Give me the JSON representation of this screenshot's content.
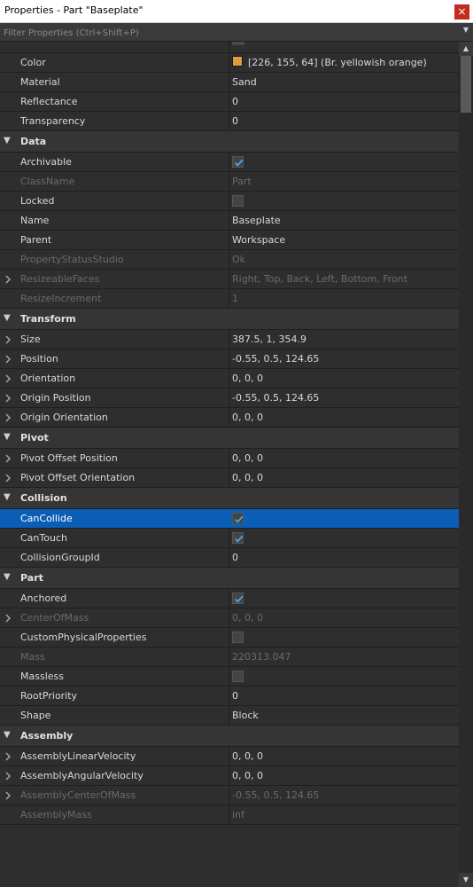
{
  "window": {
    "title": "Properties - Part \"Baseplate\"",
    "close_glyph": "×"
  },
  "filter": {
    "placeholder": "Filter Properties (Ctrl+Shift+P)"
  },
  "colors": {
    "selection": "#0a5eb6",
    "color_swatch": "#e29b40",
    "checkmark": "#4aa3f0"
  },
  "rows": [
    {
      "kind": "prop",
      "name": "Color",
      "value": "[226, 155, 64] (Br. yellowish orange)",
      "swatch": true
    },
    {
      "kind": "prop",
      "name": "Material",
      "value": "Sand"
    },
    {
      "kind": "prop",
      "name": "Reflectance",
      "value": "0"
    },
    {
      "kind": "prop",
      "name": "Transparency",
      "value": "0"
    },
    {
      "kind": "category",
      "name": "Data"
    },
    {
      "kind": "check",
      "name": "Archivable",
      "checked": true
    },
    {
      "kind": "prop",
      "name": "ClassName",
      "value": "Part",
      "disabled": true
    },
    {
      "kind": "check",
      "name": "Locked",
      "checked": false
    },
    {
      "kind": "prop",
      "name": "Name",
      "value": "Baseplate"
    },
    {
      "kind": "prop",
      "name": "Parent",
      "value": "Workspace"
    },
    {
      "kind": "prop",
      "name": "PropertyStatusStudio",
      "value": "Ok",
      "disabled": true
    },
    {
      "kind": "prop",
      "name": "ResizeableFaces",
      "value": "Right, Top, Back, Left, Bottom, Front",
      "disabled": true,
      "expandable": true
    },
    {
      "kind": "prop",
      "name": "ResizeIncrement",
      "value": "1",
      "disabled": true
    },
    {
      "kind": "category",
      "name": "Transform"
    },
    {
      "kind": "prop",
      "name": "Size",
      "value": "387.5, 1, 354.9",
      "expandable": true
    },
    {
      "kind": "prop",
      "name": "Position",
      "value": "-0.55, 0.5, 124.65",
      "expandable": true
    },
    {
      "kind": "prop",
      "name": "Orientation",
      "value": "0, 0, 0",
      "expandable": true
    },
    {
      "kind": "prop",
      "name": "Origin Position",
      "value": "-0.55, 0.5, 124.65",
      "expandable": true
    },
    {
      "kind": "prop",
      "name": "Origin Orientation",
      "value": "0, 0, 0",
      "expandable": true
    },
    {
      "kind": "category",
      "name": "Pivot"
    },
    {
      "kind": "prop",
      "name": "Pivot Offset Position",
      "value": "0, 0, 0",
      "expandable": true
    },
    {
      "kind": "prop",
      "name": "Pivot Offset Orientation",
      "value": "0, 0, 0",
      "expandable": true
    },
    {
      "kind": "category",
      "name": "Collision"
    },
    {
      "kind": "check",
      "name": "CanCollide",
      "checked": true,
      "selected": true
    },
    {
      "kind": "check",
      "name": "CanTouch",
      "checked": true
    },
    {
      "kind": "prop",
      "name": "CollisionGroupId",
      "value": "0"
    },
    {
      "kind": "category",
      "name": "Part"
    },
    {
      "kind": "check",
      "name": "Anchored",
      "checked": true
    },
    {
      "kind": "prop",
      "name": "CenterOfMass",
      "value": "0, 0, 0",
      "disabled": true,
      "expandable": true
    },
    {
      "kind": "check",
      "name": "CustomPhysicalProperties",
      "checked": false
    },
    {
      "kind": "prop",
      "name": "Mass",
      "value": "220313.047",
      "disabled": true
    },
    {
      "kind": "check",
      "name": "Massless",
      "checked": false
    },
    {
      "kind": "prop",
      "name": "RootPriority",
      "value": "0"
    },
    {
      "kind": "prop",
      "name": "Shape",
      "value": "Block"
    },
    {
      "kind": "category",
      "name": "Assembly"
    },
    {
      "kind": "prop",
      "name": "AssemblyLinearVelocity",
      "value": "0, 0, 0",
      "expandable": true
    },
    {
      "kind": "prop",
      "name": "AssemblyAngularVelocity",
      "value": "0, 0, 0",
      "expandable": true
    },
    {
      "kind": "prop",
      "name": "AssemblyCenterOfMass",
      "value": "-0.55, 0.5, 124.65",
      "disabled": true,
      "expandable": true
    },
    {
      "kind": "prop",
      "name": "AssemblyMass",
      "value": "inf",
      "disabled": true
    }
  ]
}
